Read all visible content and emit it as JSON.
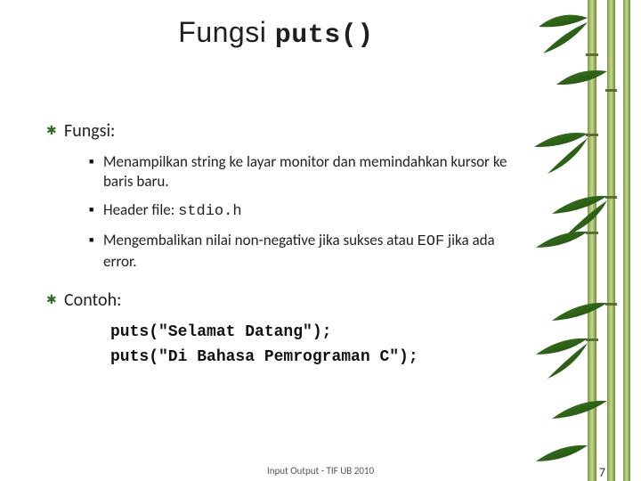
{
  "title_prefix": "Fungsi ",
  "title_code": "puts()",
  "sections": {
    "fungsi": {
      "label": "Fungsi:",
      "items": [
        {
          "text": "Menampilkan string ke layar monitor dan memindahkan kursor ke baris baru."
        },
        {
          "prefix": "Header file: ",
          "code": "stdio.h"
        },
        {
          "prefix": "Mengembalikan nilai non-negative jika sukses atau ",
          "code": "EOF",
          "suffix": " jika ada error."
        }
      ]
    },
    "contoh": {
      "label": "Contoh:",
      "code": [
        "puts(\"Selamat Datang\");",
        "puts(\"Di Bahasa Pemrograman C\");"
      ]
    }
  },
  "footer": "Input Output - TIF UB 2010",
  "page": "7"
}
